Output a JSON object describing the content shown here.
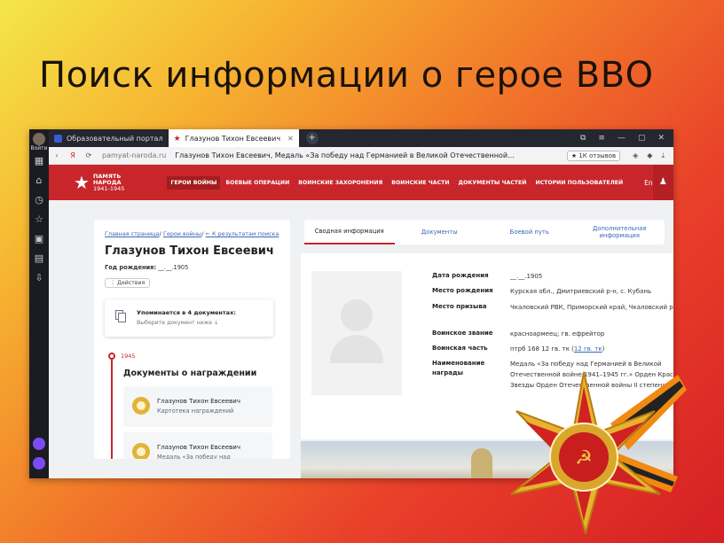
{
  "slide": {
    "title": "Поиск информации о герое ВВО"
  },
  "browser": {
    "sidebar_label": "Войти",
    "tabs": [
      {
        "label": "Образовательный портал",
        "active": false
      },
      {
        "label": "Глазунов Тихон Евсеевич",
        "active": true
      }
    ],
    "address": {
      "domain": "pamyat-naroda.ru",
      "page_title": "Глазунов Тихон Евсеевич, Медаль «За победу над Германией в Великой Отечественной...",
      "reviews": "★ 1К отзывов"
    }
  },
  "site": {
    "logo_line1": "ПАМЯТЬ",
    "logo_line2": "НАРОДА",
    "logo_line3": "1941-1945",
    "nav": [
      {
        "label": "ГЕРОИ ВОЙНЫ",
        "active": true
      },
      {
        "label": "БОЕВЫЕ ОПЕРАЦИИ",
        "active": false
      },
      {
        "label": "ВОИНСКИЕ ЗАХОРОНЕНИЯ",
        "active": false
      },
      {
        "label": "ВОИНСКИЕ ЧАСТИ",
        "active": false
      },
      {
        "label": "ДОКУМЕНТЫ ЧАСТЕЙ",
        "active": false
      },
      {
        "label": "ИСТОРИИ ПОЛЬЗОВАТЕЛЕЙ",
        "active": false
      }
    ],
    "lang": "En"
  },
  "hero": {
    "breadcrumb_home": "Главная страница",
    "breadcrumb_heroes": "Герои войны",
    "breadcrumb_back": "← К результатам поиска",
    "name": "Глазунов Тихон Евсеевич",
    "birth_label": "Год рождения:",
    "birth_value": "__.__.1905",
    "actions_label": "⋮ Действия",
    "mentions_title": "Упоминается в 4 документах:",
    "mentions_sub": "Выберите документ ниже ↓",
    "year": "1945",
    "awards_heading": "Документы о награждении",
    "cards": [
      {
        "name": "Глазунов Тихон Евсеевич",
        "type": "Картотека награждений"
      },
      {
        "name": "Глазунов Тихон Евсеевич",
        "type": "Медаль «За победу над"
      }
    ]
  },
  "info_tabs": [
    {
      "label": "Сводная информация",
      "active": true
    },
    {
      "label": "Документы",
      "active": false
    },
    {
      "label": "Боевой путь",
      "active": false
    },
    {
      "label": "Дополнительная информация",
      "active": false
    }
  ],
  "details": [
    {
      "key": "Дата рождения",
      "value": "__.__.1905"
    },
    {
      "key": "Место рождения",
      "value": "Курская обл., Дмитриевский р-н, с. Кубань"
    },
    {
      "key": "Место призыва",
      "value": "Чкаловский РВК, Приморский край, Чкаловский р-н"
    },
    {
      "key": "Воинское звание",
      "value": "красноармеец; гв. ефрейтор"
    },
    {
      "key": "Воинская часть",
      "value": "птрб 168 12 гв. тк",
      "link": "12 гв. тк"
    },
    {
      "key": "Наименование награды",
      "value": "Медаль «За победу над Германией в Великой Отечественной войне 1941–1945 гг.» Орден Красной Звезды Орден Отечественной войны II степени"
    }
  ]
}
